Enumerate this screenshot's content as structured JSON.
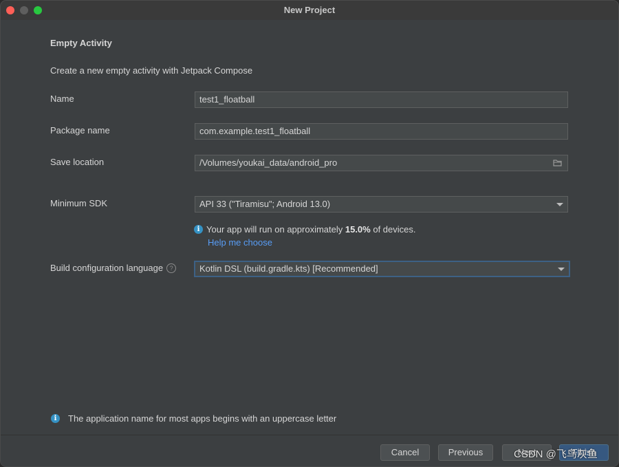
{
  "window": {
    "title": "New Project"
  },
  "form": {
    "heading": "Empty Activity",
    "description": "Create a new empty activity with Jetpack Compose",
    "name": {
      "label": "Name",
      "value": "test1_floatball"
    },
    "package": {
      "label": "Package name",
      "value": "com.example.test1_floatball"
    },
    "location": {
      "label": "Save location",
      "value": "/Volumes/youkai_data/android_pro"
    },
    "min_sdk": {
      "label": "Minimum SDK",
      "value": "API 33 (\"Tiramisu\"; Android 13.0)",
      "coverage_prefix": "Your app will run on approximately ",
      "coverage_percent": "15.0%",
      "coverage_suffix": " of devices.",
      "help_link": "Help me choose"
    },
    "build_lang": {
      "label": "Build configuration language",
      "value": "Kotlin DSL (build.gradle.kts) [Recommended]"
    },
    "hint": "The application name for most apps begins with an uppercase letter"
  },
  "buttons": {
    "cancel": "Cancel",
    "previous": "Previous",
    "next": "Next",
    "finish": "Finish"
  },
  "watermark": "CSDN @飞鸟灰鱼",
  "icons": {
    "info": "info-icon",
    "folder": "folder-icon",
    "help": "question-icon",
    "dropdown": "chevron-down-icon"
  },
  "colors": {
    "link": "#589df6",
    "info": "#3592c4",
    "focus": "#3d6185",
    "primary_button": "#365880"
  }
}
